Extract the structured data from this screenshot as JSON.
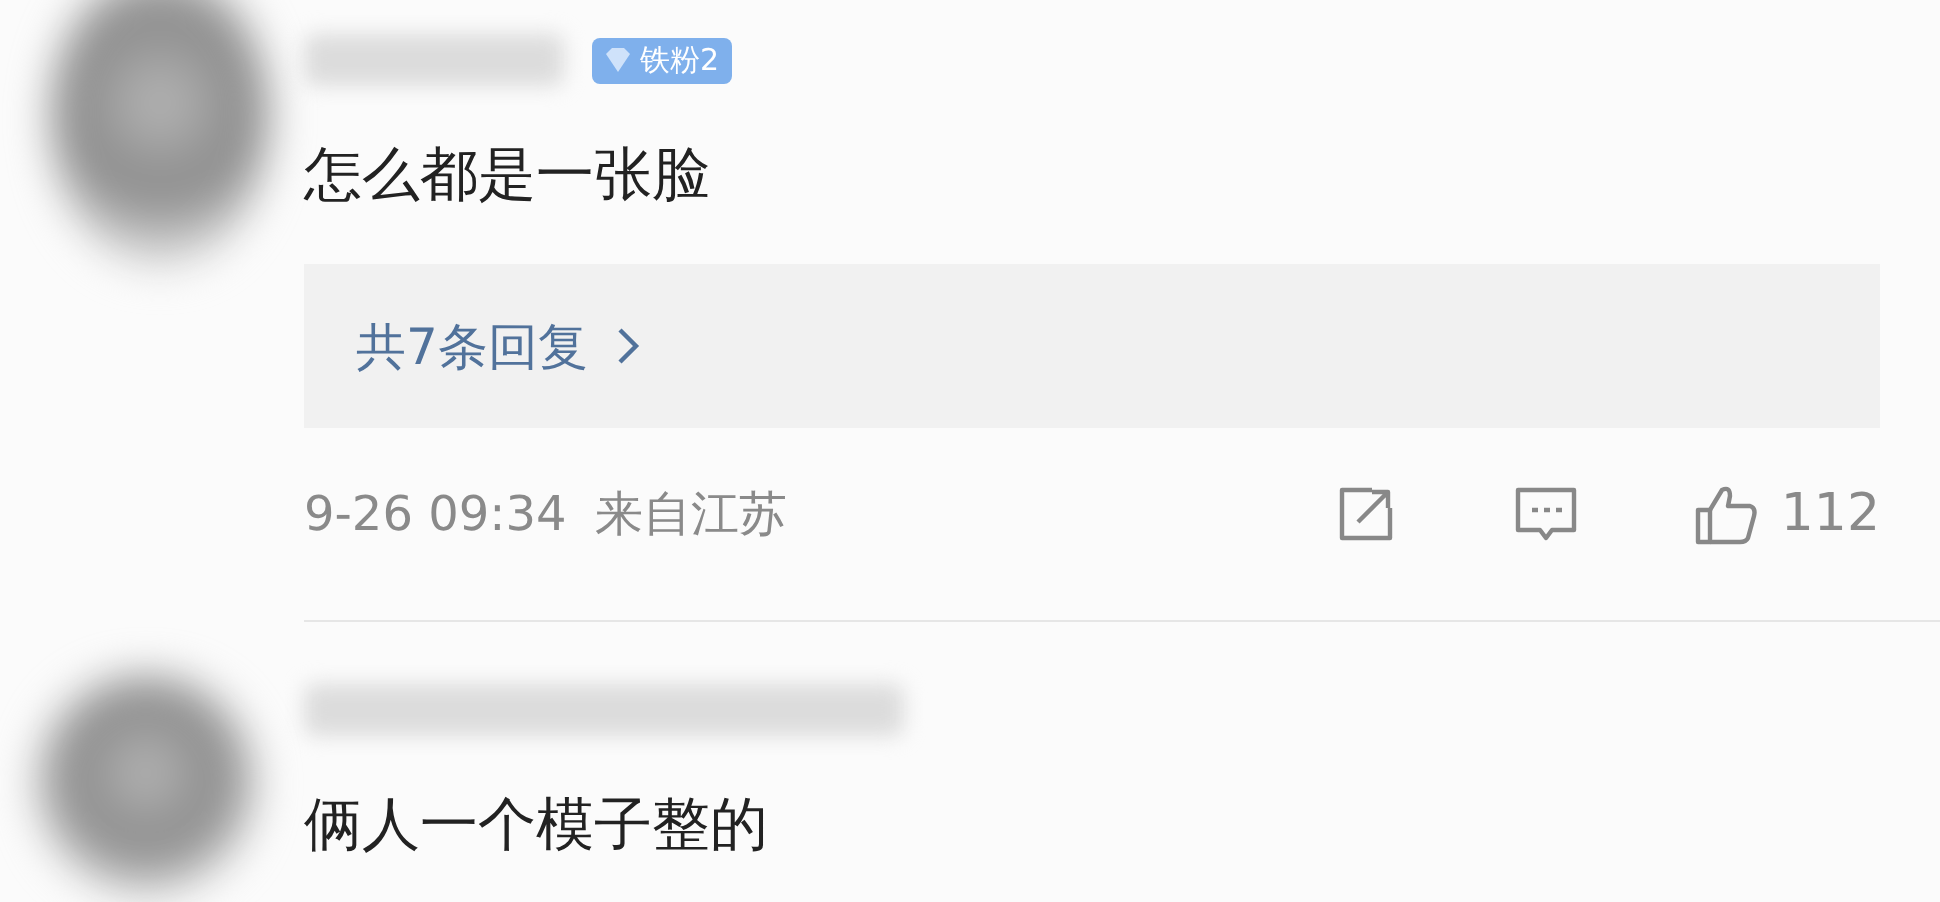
{
  "comments": [
    {
      "badge": "铁粉2",
      "text": "怎么都是一张脸",
      "replies": "共7条回复",
      "time": "9-26 09:34",
      "location": "来自江苏",
      "likes": "112"
    },
    {
      "text": "俩人一个模子整的"
    }
  ]
}
